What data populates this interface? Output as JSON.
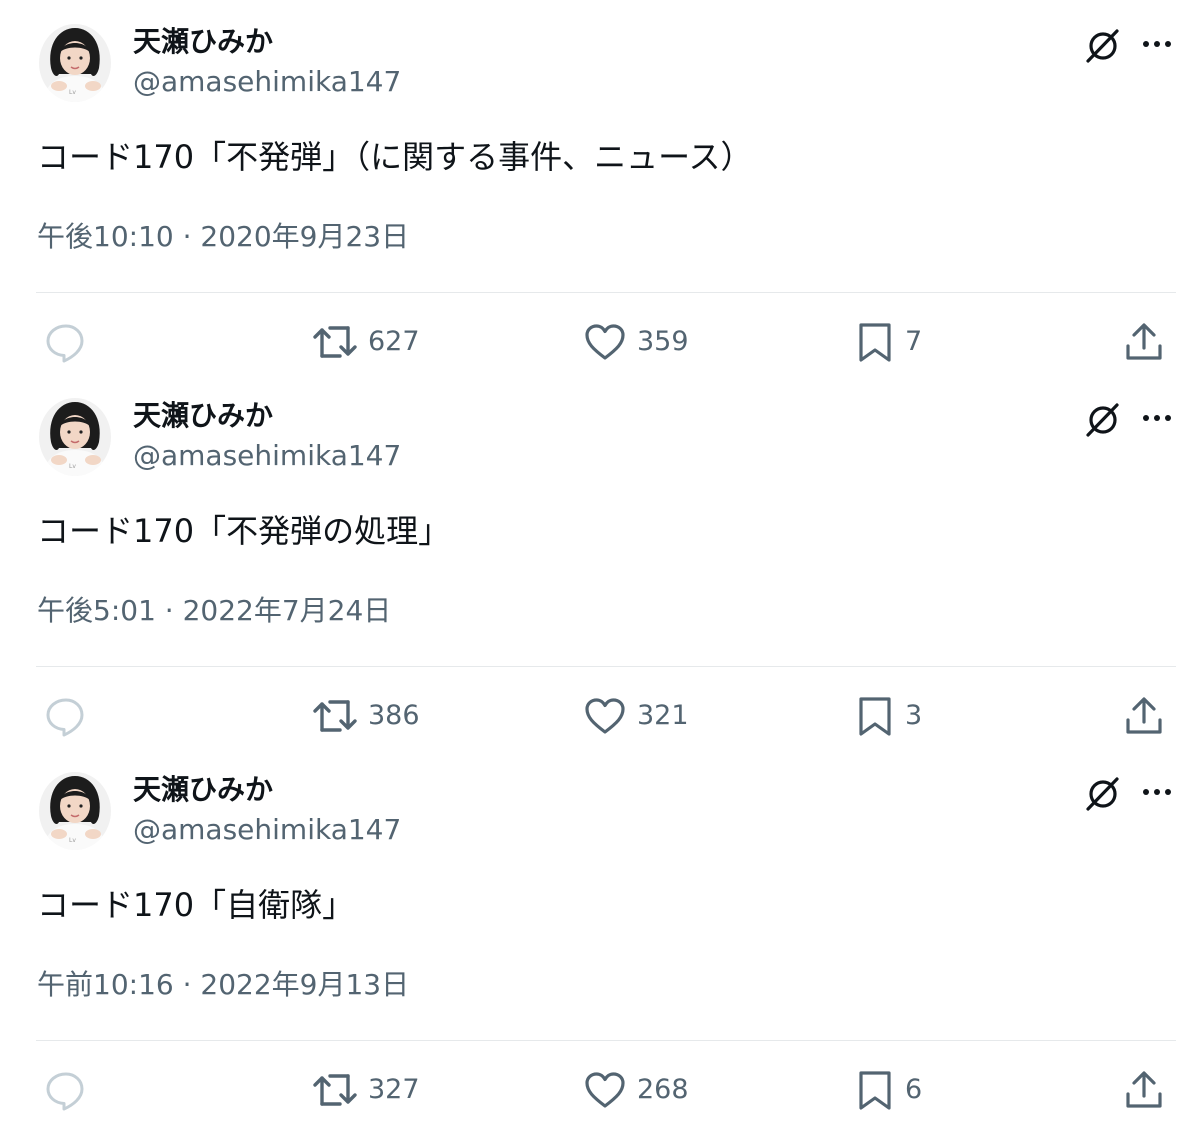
{
  "tweets": [
    {
      "display_name": "天瀬ひみか",
      "handle": "@amasehimika147",
      "text": "コード170「不発弾」（に関する事件、ニュース）",
      "timestamp": "午後10:10 · 2020年9月23日",
      "retweets": "627",
      "likes": "359",
      "bookmarks": "7"
    },
    {
      "display_name": "天瀬ひみか",
      "handle": "@amasehimika147",
      "text": "コード170「不発弾の処理」",
      "timestamp": "午後5:01 · 2022年7月24日",
      "retweets": "386",
      "likes": "321",
      "bookmarks": "3"
    },
    {
      "display_name": "天瀬ひみか",
      "handle": "@amasehimika147",
      "text": "コード170「自衛隊」",
      "timestamp": "午前10:16 · 2022年9月13日",
      "retweets": "327",
      "likes": "268",
      "bookmarks": "6"
    }
  ],
  "icons": {
    "grok": "grok-icon",
    "more": "more-icon",
    "reply": "reply-icon",
    "retweet": "retweet-icon",
    "like": "heart-icon",
    "bookmark": "bookmark-icon",
    "share": "share-icon"
  },
  "colors": {
    "text_primary": "#0f1419",
    "text_secondary": "#536471",
    "icon_gray": "#536471",
    "reply_icon_light": "#c4cfd6",
    "divider": "#e6e9eb",
    "background": "#ffffff"
  }
}
